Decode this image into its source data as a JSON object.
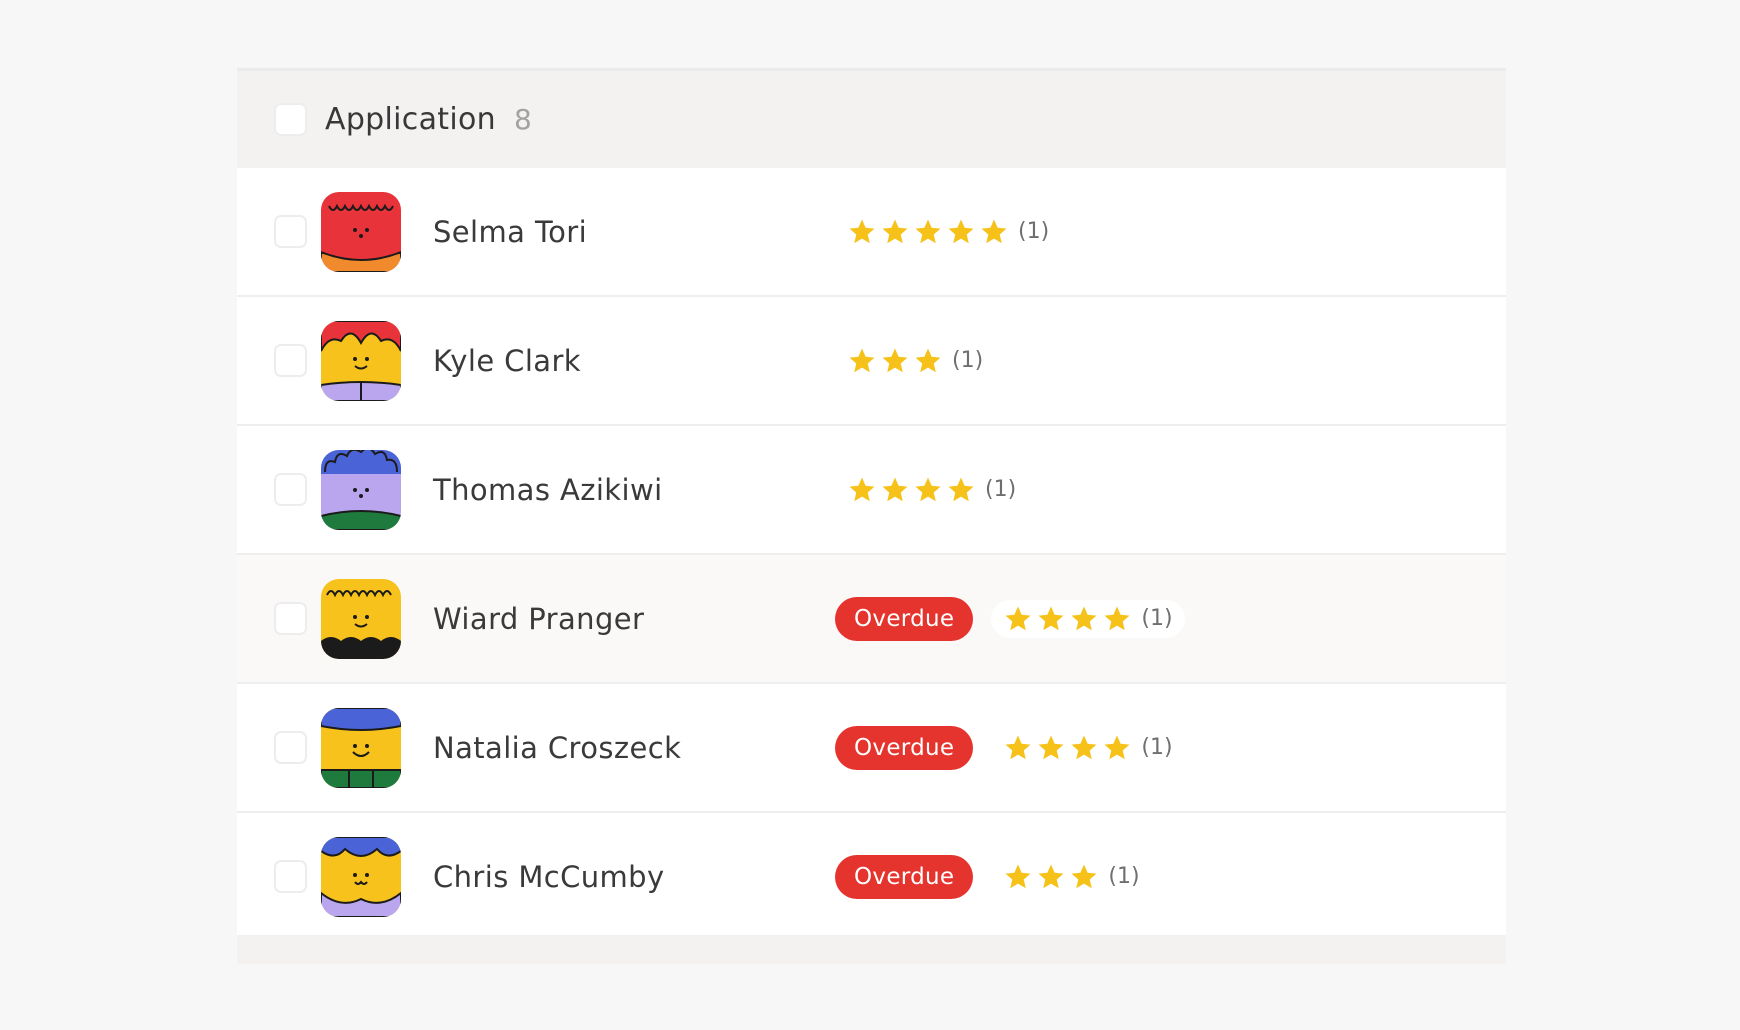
{
  "group": {
    "title": "Application",
    "count": "8"
  },
  "colors": {
    "badge": "#e5342e",
    "star": "#f6c21a",
    "header_bg": "#f3f2f1"
  },
  "candidates": [
    {
      "name": "Selma Tori",
      "rating": 5,
      "rating_count": "(1)",
      "badge": "",
      "avatar": "red-smile-avatar"
    },
    {
      "name": "Kyle Clark",
      "rating": 3,
      "rating_count": "(1)",
      "badge": "",
      "avatar": "yellow-red-hair-avatar"
    },
    {
      "name": "Thomas Azikiwi",
      "rating": 4,
      "rating_count": "(1)",
      "badge": "",
      "avatar": "purple-curly-hair-avatar"
    },
    {
      "name": "Wiard Pranger",
      "rating": 4,
      "rating_count": "(1)",
      "badge": "Overdue",
      "avatar": "yellow-black-shirt-avatar"
    },
    {
      "name": "Natalia Croszeck",
      "rating": 4,
      "rating_count": "(1)",
      "badge": "Overdue",
      "avatar": "yellow-blue-hair-avatar"
    },
    {
      "name": "Chris McCumby",
      "rating": 3,
      "rating_count": "(1)",
      "badge": "Overdue",
      "avatar": "yellow-purple-collar-avatar"
    }
  ]
}
